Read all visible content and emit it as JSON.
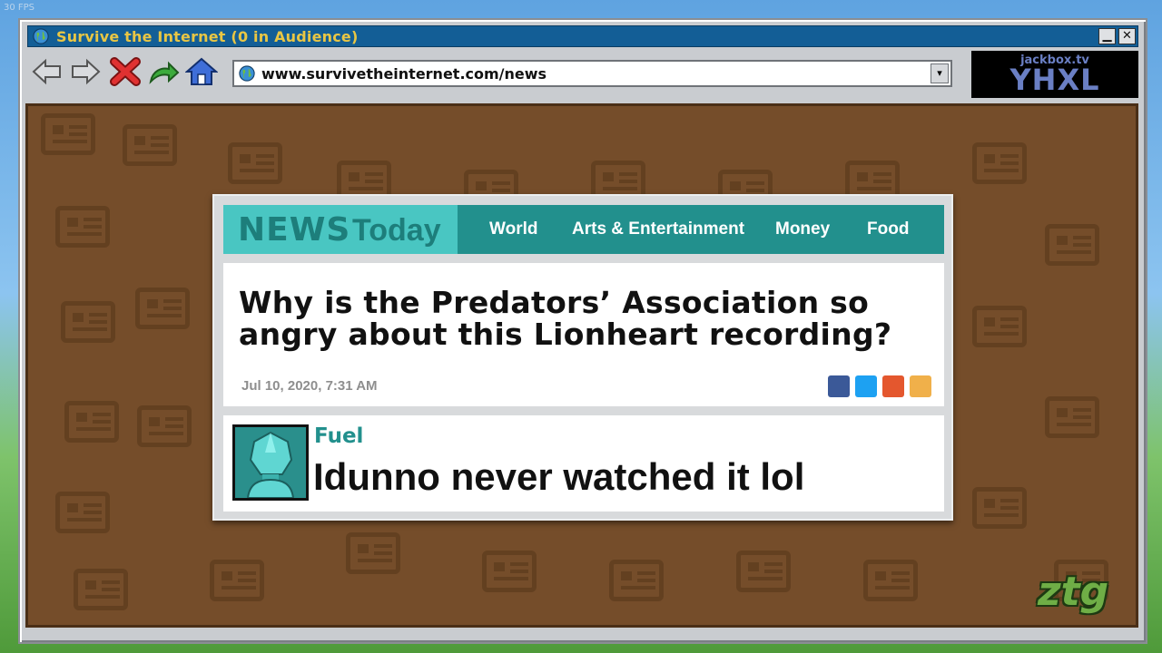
{
  "overlay": {
    "fps": "30 FPS"
  },
  "window": {
    "title": "Survive the Internet  (0 in Audience)",
    "minimize_label": "▁",
    "close_label": "✕"
  },
  "toolbar": {
    "back_icon": "back-arrow-icon",
    "forward_icon": "forward-arrow-icon",
    "stop_icon": "stop-x-icon",
    "refresh_icon": "refresh-icon",
    "home_icon": "home-icon",
    "url": "www.survivetheinternet.com/news",
    "dropdown_label": "▾"
  },
  "room": {
    "site": "jackbox.tv",
    "code": "YHXL"
  },
  "site_header": {
    "logo_news": "NEWS",
    "logo_today": "Today",
    "nav": [
      "World",
      "Arts & Entertainment",
      "Money",
      "Food"
    ]
  },
  "article": {
    "headline": "Why is the Predators’ Association so angry about this Lionheart recording?",
    "date": "Jul 10, 2020, 7:31 AM",
    "share_colors": [
      "#3b5998",
      "#1da1f2",
      "#e4572e",
      "#f0b04a"
    ]
  },
  "comment": {
    "username": "Fuel",
    "text": "Idunno never watched it lol"
  },
  "watermark": {
    "text": "ztg"
  },
  "colors": {
    "title_bar": "#135e96",
    "title_text": "#e9c644",
    "page_bg": "#754d2a",
    "teal": "#22908d",
    "teal_light": "#49c6c2"
  }
}
